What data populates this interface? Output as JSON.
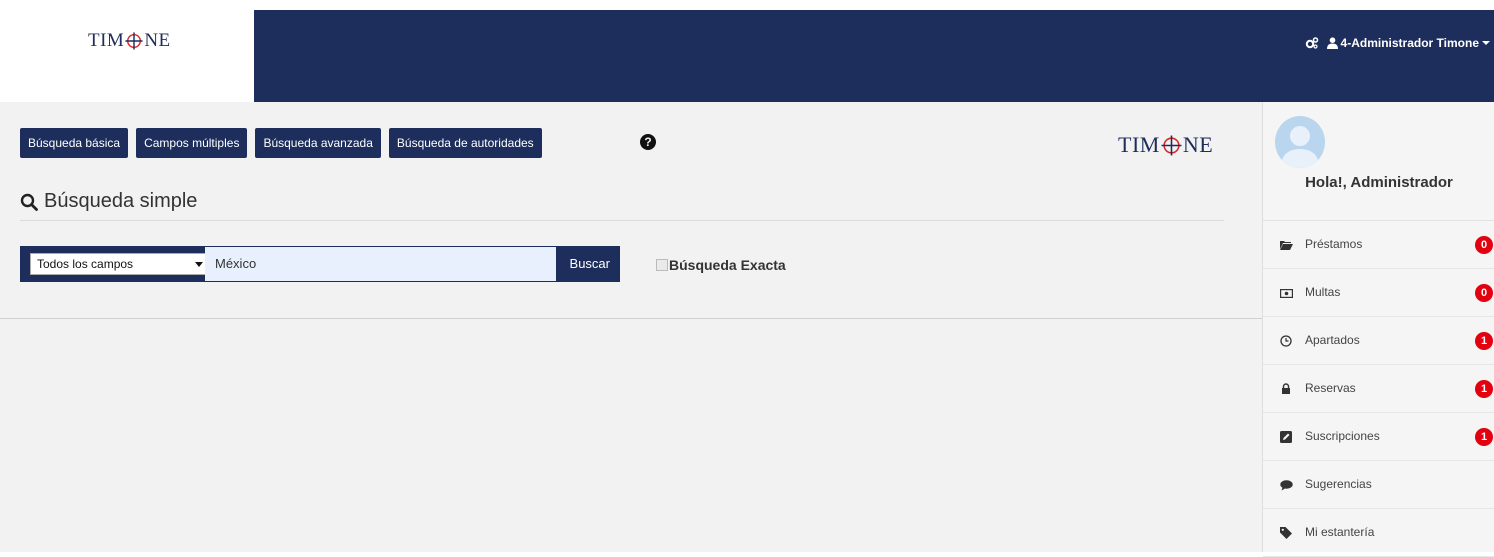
{
  "brand": {
    "logo_left": "TIM",
    "logo_right": "NE",
    "accent": "#1e2e5c",
    "logo_red": "#d7282f"
  },
  "header": {
    "user_label": "4-Administrador Timone"
  },
  "search_modes": [
    "Búsqueda básica",
    "Campos múltiples",
    "Búsqueda avanzada",
    "Búsqueda de autoridades"
  ],
  "help_label": "?",
  "page_title": "Búsqueda simple",
  "search": {
    "field_select": "Todos los campos",
    "query": "México",
    "button": "Buscar",
    "exact_label": "Búsqueda Exacta"
  },
  "sidebar": {
    "greeting": "Hola!, Administrador",
    "items": [
      {
        "label": "Préstamos",
        "badge": "0",
        "icon": "folder-icon"
      },
      {
        "label": "Multas",
        "badge": "0",
        "icon": "money-icon"
      },
      {
        "label": "Apartados",
        "badge": "1",
        "icon": "clock-icon"
      },
      {
        "label": "Reservas",
        "badge": "1",
        "icon": "lock-icon"
      },
      {
        "label": "Suscripciones",
        "badge": "1",
        "icon": "edit-icon"
      },
      {
        "label": "Sugerencias",
        "badge": "",
        "icon": "comment-icon"
      },
      {
        "label": "Mi estantería",
        "badge": "",
        "icon": "tag-icon"
      }
    ]
  }
}
